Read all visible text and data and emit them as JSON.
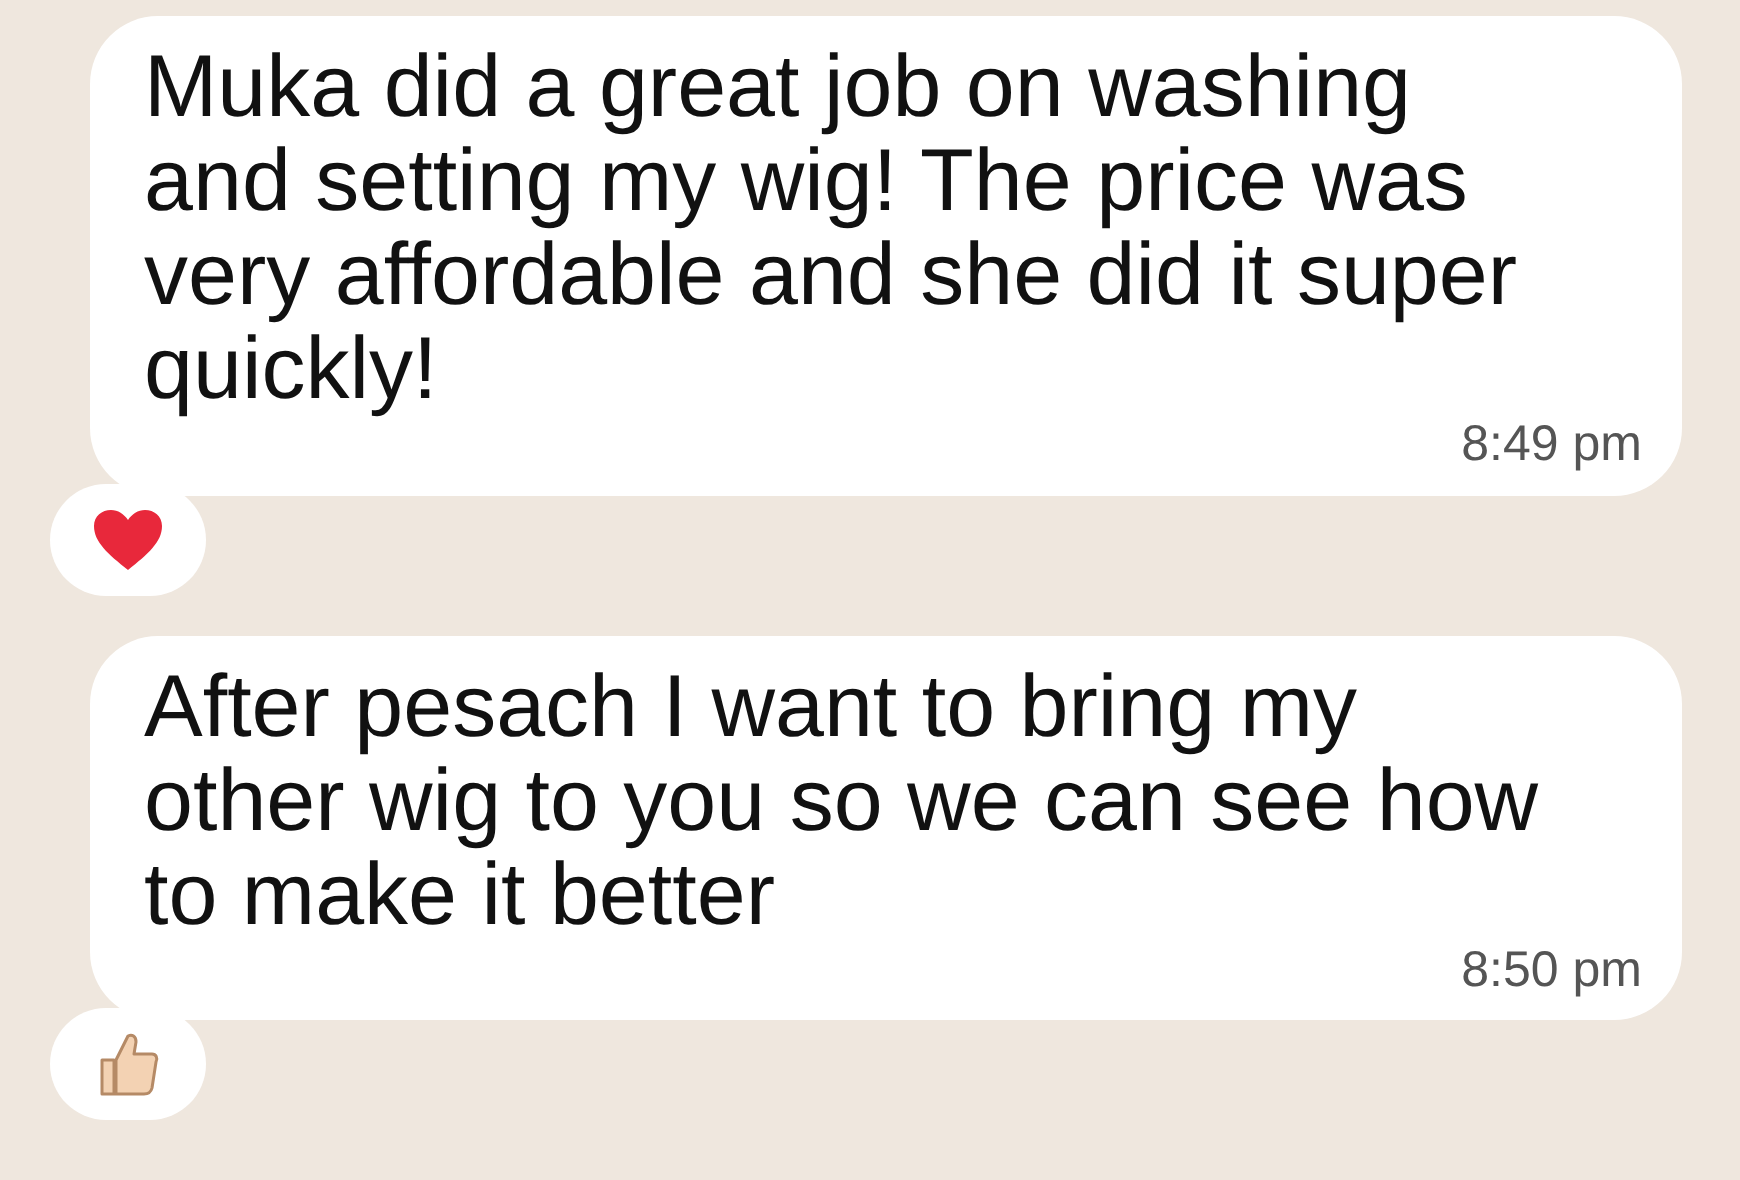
{
  "messages": [
    {
      "text": "Muka did a great job on washing and setting my wig! The price was very affordable and she did it super quickly!",
      "time": "8:49 pm",
      "reaction": {
        "kind": "heart"
      }
    },
    {
      "text": "After pesach I want to bring my other wig to you so we can see how to make it better",
      "time": "8:50 pm",
      "reaction": {
        "kind": "thumbs_up"
      }
    }
  ]
}
